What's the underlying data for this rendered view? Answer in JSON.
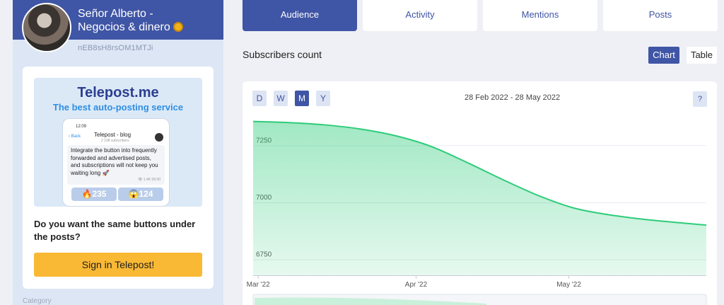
{
  "channel": {
    "name_line1": "Señor Alberto -",
    "name_line2": "Negocios & dinero",
    "id": "nEB8sH8rsOM1MTJi"
  },
  "promo": {
    "title": "Telepost.me",
    "subtitle": "The best auto-posting service",
    "phone": {
      "time": "12:09",
      "back": "‹ Back",
      "title": "Telepost - blog",
      "subscribers": "2 198 subscribers",
      "message": "Integrate the button into frequently forwarded and advertised posts, and subscriptions will not keep you waiting long 🚀",
      "msg_meta": "👁 1.4K  09:30",
      "reaction1": "🔥235",
      "reaction2": "😱124"
    },
    "question": "Do you want the same buttons under the posts?",
    "signin_label": "Sign in Telepost!"
  },
  "sidebar": {
    "category_label": "Category"
  },
  "tabs": [
    {
      "label": "Audience",
      "active": true
    },
    {
      "label": "Activity",
      "active": false
    },
    {
      "label": "Mentions",
      "active": false
    },
    {
      "label": "Posts",
      "active": false
    }
  ],
  "section_title": "Subscribers count",
  "view_toggle": {
    "chart": "Chart",
    "table": "Table",
    "selected": "Chart"
  },
  "period_buttons": [
    {
      "label": "D",
      "active": false
    },
    {
      "label": "W",
      "active": false
    },
    {
      "label": "M",
      "active": true
    },
    {
      "label": "Y",
      "active": false
    }
  ],
  "date_range": "28 Feb 2022 - 28 May 2022",
  "help_label": "?",
  "colors": {
    "accent": "#3f55a5",
    "line": "#2ecc7a",
    "fill": "#c9f0da",
    "button": "#f9b934"
  },
  "chart_data": {
    "type": "area",
    "x": [
      "2022-02-28",
      "2022-03-07",
      "2022-03-14",
      "2022-03-21",
      "2022-03-28",
      "2022-04-04",
      "2022-04-11",
      "2022-04-18",
      "2022-04-25",
      "2022-05-02",
      "2022-05-09",
      "2022-05-16",
      "2022-05-23",
      "2022-05-28"
    ],
    "series": [
      {
        "values": [
          7355,
          7350,
          7340,
          7322,
          7292,
          7245,
          7175,
          7100,
          7030,
          6975,
          6945,
          6925,
          6910,
          6900
        ]
      }
    ],
    "x_tick_labels": [
      "Mar '22",
      "Apr '22",
      "May '22"
    ],
    "x_ticks": [
      "2022-03-01",
      "2022-04-01",
      "2022-05-01"
    ],
    "y_tick_labels": [
      "6750",
      "7000",
      "7250"
    ],
    "y_ticks": [
      6750,
      7000,
      7250
    ],
    "xlim": [
      "2022-02-28",
      "2022-05-28"
    ],
    "ylim": [
      6680,
      7360
    ],
    "grid": true
  }
}
